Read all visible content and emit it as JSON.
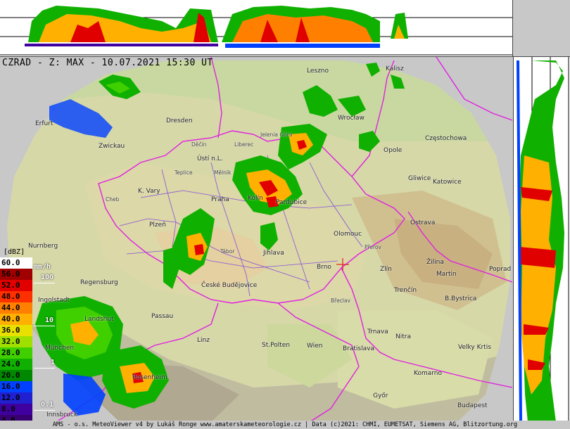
{
  "title": "CZRAD - Z: MAX - 10.07.2021 15:30 UT",
  "footer": "AMS - o.s. MeteoViewer v4 by Lukáš Ronge www.amaterskameteorologie.cz | Data (c)2021: CHMI, EUMETSAT, Siemens AG, Blitzortung.org",
  "legend": {
    "unit_dbz": "[dBZ]",
    "unit_rain": "mm/h",
    "rows": [
      {
        "value": "60.0",
        "color": "#ffffff",
        "text_color": "#000000"
      },
      {
        "value": "56.0",
        "color": "#a00000",
        "text_color": "#000000"
      },
      {
        "value": "52.0",
        "color": "#e00000",
        "text_color": "#000000"
      },
      {
        "value": "48.0",
        "color": "#ff3000",
        "text_color": "#000000"
      },
      {
        "value": "44.0",
        "color": "#ff8000",
        "text_color": "#000000"
      },
      {
        "value": "40.0",
        "color": "#ffb000",
        "text_color": "#000000"
      },
      {
        "value": "36.0",
        "color": "#e8e000",
        "text_color": "#000000"
      },
      {
        "value": "32.0",
        "color": "#a0e000",
        "text_color": "#000000"
      },
      {
        "value": "28.0",
        "color": "#40d000",
        "text_color": "#000000"
      },
      {
        "value": "24.0",
        "color": "#10b000",
        "text_color": "#000000"
      },
      {
        "value": "20.0",
        "color": "#008800",
        "text_color": "#000000"
      },
      {
        "value": "16.0",
        "color": "#0040ff",
        "text_color": "#000000"
      },
      {
        "value": "12.0",
        "color": "#2020d0",
        "text_color": "#000000"
      },
      {
        "value": "8.0",
        "color": "#4000a0",
        "text_color": "#000000"
      },
      {
        "value": "4.0",
        "color": "#380070",
        "text_color": "#000000"
      }
    ],
    "rain_labels": [
      "100",
      "10",
      "1",
      "0.1"
    ]
  },
  "cities": [
    {
      "name": "Leszno",
      "size": "normal"
    },
    {
      "name": "Kalisz",
      "size": "normal"
    },
    {
      "name": "Dresden",
      "size": "normal"
    },
    {
      "name": "Wrocław",
      "size": "normal"
    },
    {
      "name": "Częstochowa",
      "size": "normal"
    },
    {
      "name": "Opole",
      "size": "normal"
    },
    {
      "name": "Erfurt",
      "size": "normal"
    },
    {
      "name": "Zwickau",
      "size": "normal"
    },
    {
      "name": "Jelenia Góra",
      "size": "small"
    },
    {
      "name": "Děčín",
      "size": "small"
    },
    {
      "name": "Liberec",
      "size": "small"
    },
    {
      "name": "Ústí n.L.",
      "size": "normal"
    },
    {
      "name": "Gliwice",
      "size": "normal"
    },
    {
      "name": "Katowice",
      "size": "normal"
    },
    {
      "name": "Teplice",
      "size": "small"
    },
    {
      "name": "Mělník",
      "size": "small"
    },
    {
      "name": "K. Vary",
      "size": "normal"
    },
    {
      "name": "Cheb",
      "size": "small"
    },
    {
      "name": "Praha",
      "size": "normal"
    },
    {
      "name": "Kolín",
      "size": "normal"
    },
    {
      "name": "Pardubice",
      "size": "normal"
    },
    {
      "name": "Ostrava",
      "size": "normal"
    },
    {
      "name": "Plzeň",
      "size": "normal"
    },
    {
      "name": "Olomouc",
      "size": "normal"
    },
    {
      "name": "Nurnberg",
      "size": "normal"
    },
    {
      "name": "Tábor",
      "size": "small"
    },
    {
      "name": "Jihlava",
      "size": "normal"
    },
    {
      "name": "Přerov",
      "size": "small"
    },
    {
      "name": "Žilina",
      "size": "normal"
    },
    {
      "name": "Martin",
      "size": "normal"
    },
    {
      "name": "Poprad",
      "size": "normal"
    },
    {
      "name": "Brno",
      "size": "normal"
    },
    {
      "name": "Zlín",
      "size": "normal"
    },
    {
      "name": "Regensburg",
      "size": "normal"
    },
    {
      "name": "České Budějovice",
      "size": "normal"
    },
    {
      "name": "Trenčín",
      "size": "normal"
    },
    {
      "name": "B.Bystrica",
      "size": "normal"
    },
    {
      "name": "Ingolstadt",
      "size": "normal"
    },
    {
      "name": "Břeclav",
      "size": "small"
    },
    {
      "name": "Passau",
      "size": "normal"
    },
    {
      "name": "Landshut",
      "size": "normal"
    },
    {
      "name": "Trnava",
      "size": "normal"
    },
    {
      "name": "Nitra",
      "size": "normal"
    },
    {
      "name": "Linz",
      "size": "normal"
    },
    {
      "name": "München",
      "size": "normal"
    },
    {
      "name": "St.Polten",
      "size": "normal"
    },
    {
      "name": "Wien",
      "size": "normal"
    },
    {
      "name": "Bratislava",
      "size": "normal"
    },
    {
      "name": "Velky Krtis",
      "size": "normal"
    },
    {
      "name": "Rosenheim",
      "size": "normal"
    },
    {
      "name": "Komarno",
      "size": "normal"
    },
    {
      "name": "Győr",
      "size": "normal"
    },
    {
      "name": "Budapest",
      "size": "normal"
    },
    {
      "name": "Innsbruck",
      "size": "normal"
    }
  ]
}
